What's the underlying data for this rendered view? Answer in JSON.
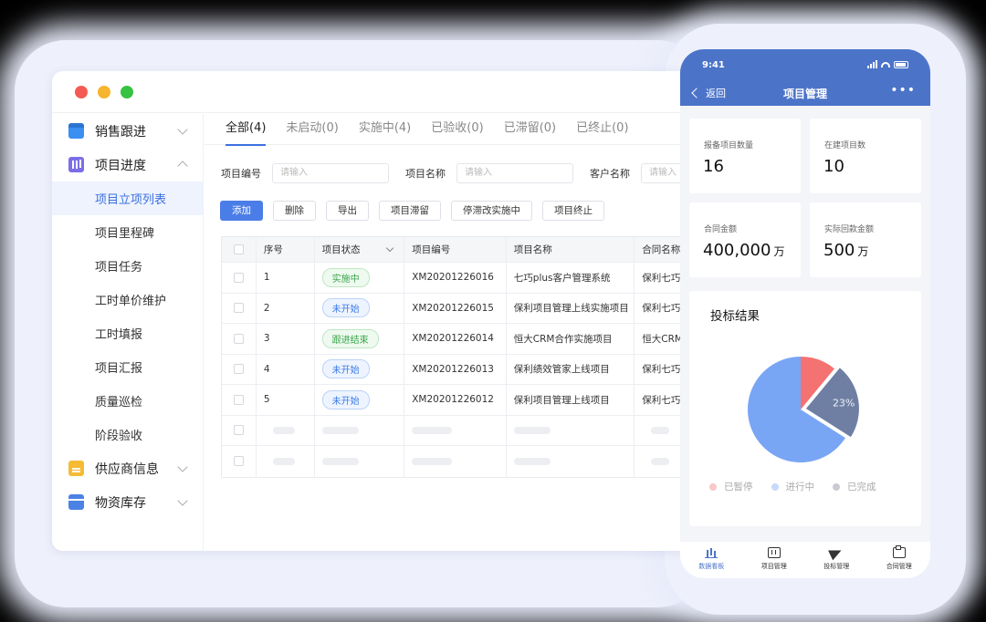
{
  "desktop": {
    "sidebar": [
      {
        "type": "group",
        "label": "销售跟进",
        "icon": "calendar-icon",
        "expanded": false
      },
      {
        "type": "group",
        "label": "项目进度",
        "icon": "project-icon",
        "expanded": true
      },
      {
        "type": "sub",
        "label": "项目立项列表",
        "active": true
      },
      {
        "type": "sub",
        "label": "项目里程碑"
      },
      {
        "type": "sub",
        "label": "项目任务"
      },
      {
        "type": "sub",
        "label": "工时单价维护"
      },
      {
        "type": "sub",
        "label": "工时填报"
      },
      {
        "type": "sub",
        "label": "项目汇报"
      },
      {
        "type": "sub",
        "label": "质量巡检"
      },
      {
        "type": "sub",
        "label": "阶段验收"
      },
      {
        "type": "group",
        "label": "供应商信息",
        "icon": "document-icon",
        "expanded": false
      },
      {
        "type": "group",
        "label": "物资库存",
        "icon": "box-icon",
        "expanded": false
      }
    ],
    "tabs": [
      "全部(4)",
      "未启动(0)",
      "实施中(4)",
      "已验收(0)",
      "已滞留(0)",
      "已终止(0)"
    ],
    "filters": [
      {
        "label": "项目编号",
        "placeholder": "请输入"
      },
      {
        "label": "项目名称",
        "placeholder": "请输入"
      },
      {
        "label": "客户名称",
        "placeholder": "请输入"
      }
    ],
    "actions": [
      "添加",
      "删除",
      "导出",
      "项目滞留",
      "停滞改实施中",
      "项目终止"
    ],
    "table": {
      "headers": [
        "序号",
        "项目状态",
        "项目编号",
        "项目名称",
        "合同名称"
      ],
      "rows": [
        {
          "index": "1",
          "status": "实施中",
          "status_kind": "impl",
          "code": "XM20201226016",
          "name": "七巧plus客户管理系统",
          "contract": "保利七巧"
        },
        {
          "index": "2",
          "status": "未开始",
          "status_kind": "not",
          "code": "XM20201226015",
          "name": "保利项目管理上线实施项目",
          "contract": "保利七巧"
        },
        {
          "index": "3",
          "status": "跟进结束",
          "status_kind": "end",
          "code": "XM20201226014",
          "name": "恒大CRM合作实施项目",
          "contract": "恒大CRM"
        },
        {
          "index": "4",
          "status": "未开始",
          "status_kind": "not",
          "code": "XM20201226013",
          "name": "保利绩效管家上线项目",
          "contract": "保利七巧"
        },
        {
          "index": "5",
          "status": "未开始",
          "status_kind": "not",
          "code": "XM20201226012",
          "name": "保利项目管理上线项目",
          "contract": "保利七巧"
        }
      ],
      "skeleton_rows": 2
    }
  },
  "phone": {
    "time": "9:41",
    "back_label": "返回",
    "title": "项目管理",
    "more": "•••",
    "stats": [
      {
        "label": "报备项目数量",
        "value": "16",
        "unit": ""
      },
      {
        "label": "在建项目数",
        "value": "10",
        "unit": ""
      },
      {
        "label": "合同金额",
        "value": "400,000",
        "unit": "万"
      },
      {
        "label": "实际回款金额",
        "value": "500",
        "unit": "万"
      }
    ],
    "chart_title": "投标结果",
    "tabbar": [
      {
        "label": "数据看板",
        "icon": "chart-icon",
        "active": true
      },
      {
        "label": "项目管理",
        "icon": "project-icon",
        "active": false
      },
      {
        "label": "投标管理",
        "icon": "paper-plane-icon",
        "active": false
      },
      {
        "label": "合同管理",
        "icon": "clipboard-icon",
        "active": false
      }
    ]
  },
  "colors": {
    "accent": "#4b7de8",
    "phone_header": "#4b74c9",
    "pie_paused": "#f47271",
    "pie_in_progress": "#79a5f5",
    "pie_done": "#6f7fa3"
  },
  "chart_data": {
    "type": "pie",
    "title": "投标结果",
    "slices": [
      {
        "name": "已暂停",
        "value": 11,
        "color": "#f47271"
      },
      {
        "name": "已完成",
        "value": 23,
        "color": "#6f7fa3",
        "label": "23%"
      },
      {
        "name": "进行中",
        "value": 66,
        "color": "#79a5f5"
      }
    ],
    "legend": [
      "已暂停",
      "进行中",
      "已完成"
    ],
    "legend_colors": [
      "#f9c8c8",
      "#c7d9fb",
      "#c9cbd2"
    ],
    "legend_position": "bottom"
  }
}
